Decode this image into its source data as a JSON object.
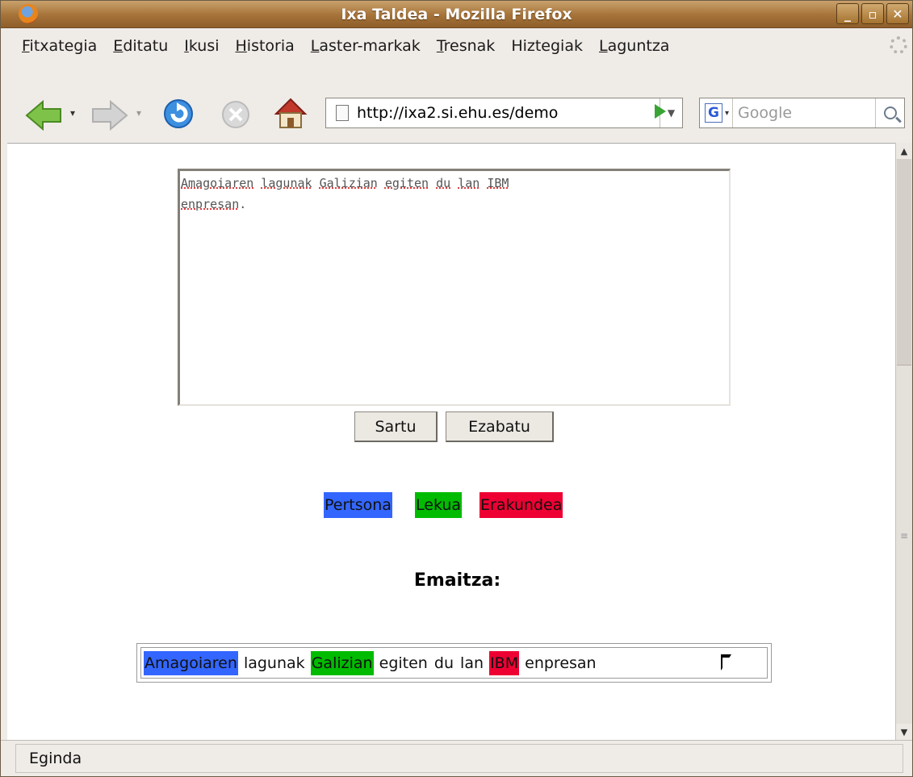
{
  "window": {
    "title": "Ixa Taldea - Mozilla Firefox"
  },
  "menubar": {
    "items": [
      {
        "label": "Fitxategia",
        "accel": "F",
        "rest": "itxategia"
      },
      {
        "label": "Editatu",
        "accel": "E",
        "rest": "ditatu"
      },
      {
        "label": "Ikusi",
        "accel": "I",
        "rest": "kusi"
      },
      {
        "label": "Historia",
        "accel": "H",
        "rest": "istoria"
      },
      {
        "label": "Laster-markak",
        "accel": "L",
        "rest": "aster-markak"
      },
      {
        "label": "Tresnak",
        "accel": "T",
        "rest": "resnak"
      },
      {
        "label": "Hiztegiak",
        "accel": "",
        "rest": "Hiztegiak"
      },
      {
        "label": "Laguntza",
        "accel": "L",
        "rest": "aguntza"
      }
    ]
  },
  "toolbar": {
    "url": "http://ixa2.si.ehu.es/demo",
    "search_placeholder": "Google"
  },
  "form": {
    "textarea_value": "Amagoiaren lagunak Galizian egiten du lan IBM enpresan.",
    "textarea_line1": [
      "Amagoiaren",
      "lagunak",
      "Galizian",
      "egiten",
      "du",
      "lan",
      "IBM"
    ],
    "textarea_line2_word": "enpresan",
    "textarea_line2_punct": ".",
    "submit_label": "Sartu",
    "clear_label": "Ezabatu"
  },
  "legend": {
    "items": [
      {
        "label": "Pertsona",
        "color": "#3366ff"
      },
      {
        "label": "Lekua",
        "color": "#00bb00"
      },
      {
        "label": "Erakundea",
        "color": "#ee0033"
      }
    ]
  },
  "result": {
    "heading": "Emaitza:",
    "tokens": [
      {
        "text": "Amagoiaren",
        "entity": "Pertsona",
        "color": "#3366ff"
      },
      {
        "text": "lagunak",
        "entity": "",
        "color": ""
      },
      {
        "text": "Galizian",
        "entity": "Lekua",
        "color": "#00bb00"
      },
      {
        "text": "egiten",
        "entity": "",
        "color": ""
      },
      {
        "text": "du",
        "entity": "",
        "color": ""
      },
      {
        "text": "lan",
        "entity": "",
        "color": ""
      },
      {
        "text": "IBM",
        "entity": "Erakundea",
        "color": "#ee0033"
      },
      {
        "text": "enpresan",
        "entity": "",
        "color": ""
      }
    ]
  },
  "statusbar": {
    "text": "Eginda"
  }
}
